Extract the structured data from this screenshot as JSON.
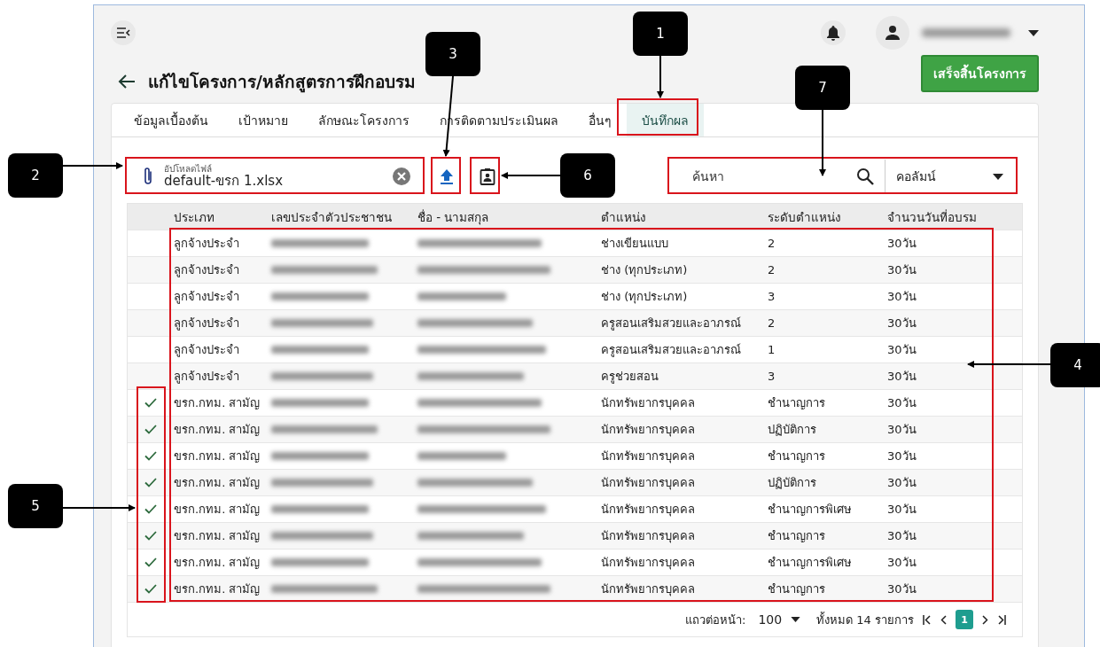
{
  "title": "แก้ไขโครงการ/หลักสูตรการฝึกอบรม",
  "finish_button": "เสร็จสิ้นโครงการ",
  "tabs": [
    {
      "label": "ข้อมูลเบื้องต้น",
      "selected": false
    },
    {
      "label": "เป้าหมาย",
      "selected": false
    },
    {
      "label": "ลักษณะโครงการ",
      "selected": false
    },
    {
      "label": "การติดตามประเมินผล",
      "selected": false
    },
    {
      "label": "อื่นๆ",
      "selected": false
    },
    {
      "label": "บันทึกผล",
      "selected": true
    }
  ],
  "upload": {
    "label": "อัปโหลดไฟล์",
    "value": "default-ขรก 1.xlsx"
  },
  "search": {
    "placeholder": "ค้นหา"
  },
  "column_select": {
    "value": "คอลัมน์"
  },
  "table": {
    "columns": [
      "ประเภท",
      "เลขประจำตัวประชาชน",
      "ชื่อ - นามสกุล",
      "ตำแหน่ง",
      "ระดับตำแหน่ง",
      "จำนวนวันที่อบรม"
    ],
    "rows": [
      {
        "checked": false,
        "type": "ลูกจ้างประจำ",
        "position": "ช่างเขียนแบบ",
        "level": "2",
        "days": "30วัน"
      },
      {
        "checked": false,
        "type": "ลูกจ้างประจำ",
        "position": "ช่าง (ทุกประเภท)",
        "level": "2",
        "days": "30วัน"
      },
      {
        "checked": false,
        "type": "ลูกจ้างประจำ",
        "position": "ช่าง (ทุกประเภท)",
        "level": "3",
        "days": "30วัน"
      },
      {
        "checked": false,
        "type": "ลูกจ้างประจำ",
        "position": "ครูสอนเสริมสวยและอาภรณ์",
        "level": "2",
        "days": "30วัน"
      },
      {
        "checked": false,
        "type": "ลูกจ้างประจำ",
        "position": "ครูสอนเสริมสวยและอาภรณ์",
        "level": "1",
        "days": "30วัน"
      },
      {
        "checked": false,
        "type": "ลูกจ้างประจำ",
        "position": "ครูช่วยสอน",
        "level": "3",
        "days": "30วัน"
      },
      {
        "checked": true,
        "type": "ขรก.กทม. สามัญ",
        "position": "นักทรัพยากรบุคคล",
        "level": "ชำนาญการ",
        "days": "30วัน"
      },
      {
        "checked": true,
        "type": "ขรก.กทม. สามัญ",
        "position": "นักทรัพยากรบุคคล",
        "level": "ปฏิบัติการ",
        "days": "30วัน"
      },
      {
        "checked": true,
        "type": "ขรก.กทม. สามัญ",
        "position": "นักทรัพยากรบุคคล",
        "level": "ชำนาญการ",
        "days": "30วัน"
      },
      {
        "checked": true,
        "type": "ขรก.กทม. สามัญ",
        "position": "นักทรัพยากรบุคคล",
        "level": "ปฏิบัติการ",
        "days": "30วัน"
      },
      {
        "checked": true,
        "type": "ขรก.กทม. สามัญ",
        "position": "นักทรัพยากรบุคคล",
        "level": "ชำนาญการพิเศษ",
        "days": "30วัน"
      },
      {
        "checked": true,
        "type": "ขรก.กทม. สามัญ",
        "position": "นักทรัพยากรบุคคล",
        "level": "ชำนาญการ",
        "days": "30วัน"
      },
      {
        "checked": true,
        "type": "ขรก.กทม. สามัญ",
        "position": "นักทรัพยากรบุคคล",
        "level": "ชำนาญการพิเศษ",
        "days": "30วัน"
      },
      {
        "checked": true,
        "type": "ขรก.กทม. สามัญ",
        "position": "นักทรัพยากรบุคคล",
        "level": "ชำนาญการ",
        "days": "30วัน"
      }
    ]
  },
  "pager": {
    "rows_label": "แถวต่อหน้า:",
    "rows_value": "100",
    "total": "ทั้งหมด 14 รายการ",
    "pages": [
      {
        "label": "1",
        "selected": true
      }
    ]
  },
  "annotations": [
    {
      "label": "1"
    },
    {
      "label": "2"
    },
    {
      "label": "3"
    },
    {
      "label": "4"
    },
    {
      "label": "5"
    },
    {
      "label": "6"
    },
    {
      "label": "7"
    }
  ]
}
